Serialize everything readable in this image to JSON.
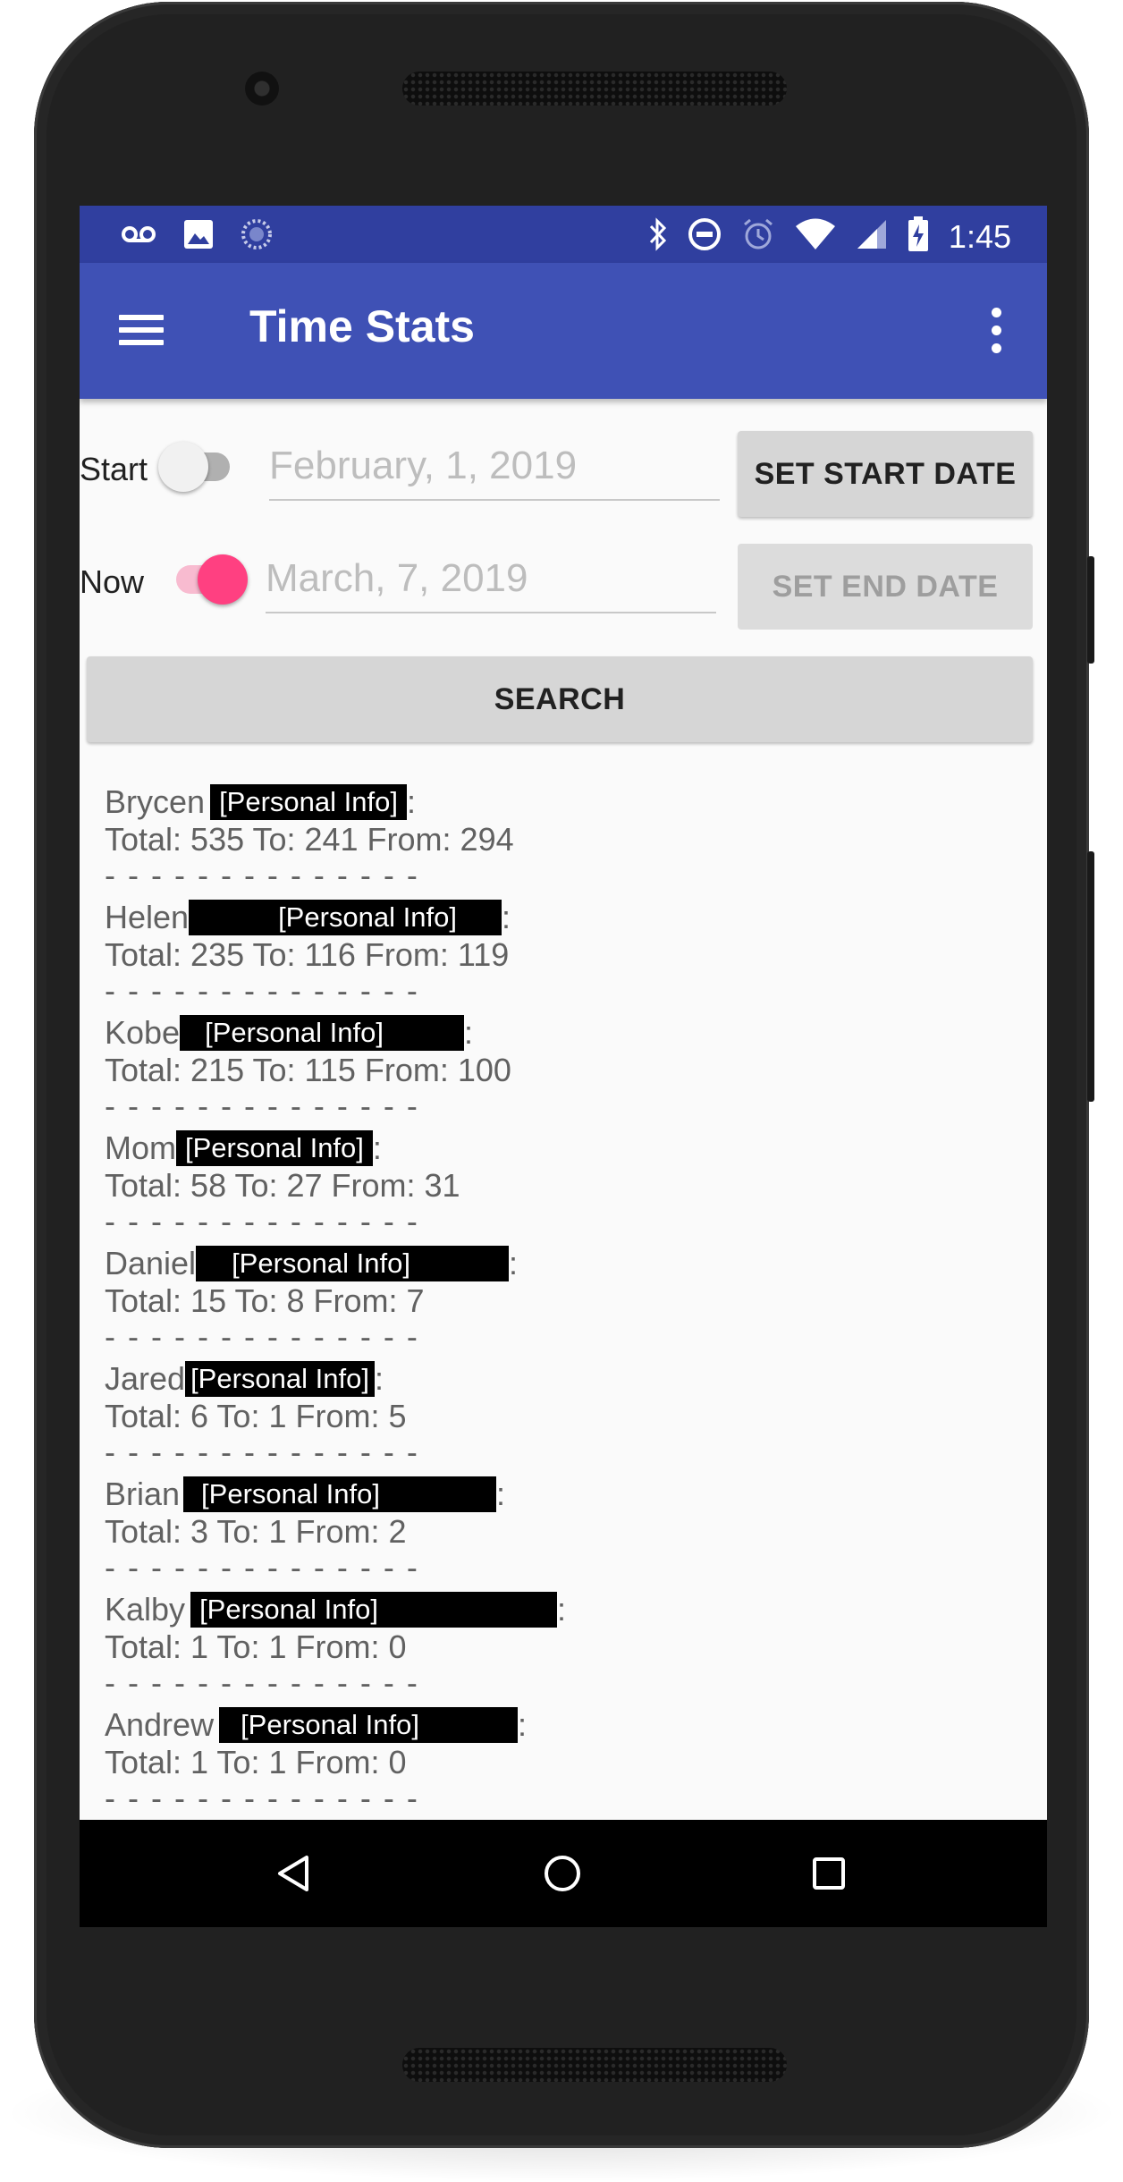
{
  "status_bar": {
    "left_icons": [
      "voicemail-icon",
      "image-icon",
      "sync-icon"
    ],
    "right_icons": [
      "bluetooth-icon",
      "do-not-disturb-icon",
      "alarm-icon",
      "wifi-icon",
      "signal-icon",
      "battery-charging-icon"
    ],
    "time": "1:45"
  },
  "app_bar": {
    "title": "Time Stats"
  },
  "controls": {
    "start_label": "Start",
    "start_switch_on": false,
    "start_date_placeholder": "February, 1, 2019",
    "set_start_label": "SET START DATE",
    "now_label": "Now",
    "now_switch_on": true,
    "end_date_placeholder": "March, 7, 2019",
    "set_end_label": "SET END DATE",
    "search_label": "SEARCH"
  },
  "results": [
    {
      "name": "Brycen",
      "redacted": "[Personal Info]",
      "stats": "Total: 535 To: 241 From: 294",
      "sep": "- - - - - - - - - - - - - -"
    },
    {
      "name": "Helen",
      "redacted": "[Personal Info]",
      "stats": "Total: 235 To: 116 From: 119",
      "sep": "- - - - - - - - - - - - - -"
    },
    {
      "name": "Kobe",
      "redacted": "[Personal Info]",
      "stats": "Total: 215 To: 115 From: 100",
      "sep": "- - - - - - - - - - - - - -"
    },
    {
      "name": "Mom",
      "redacted": "[Personal Info]",
      "stats": "Total: 58 To: 27 From: 31",
      "sep": "- - - - - - - - - - - - - -"
    },
    {
      "name": "Daniel",
      "redacted": "[Personal Info]",
      "stats": "Total: 15 To: 8 From: 7",
      "sep": "- - - - - - - - - - - - - -"
    },
    {
      "name": "Jared",
      "redacted": "[Personal Info]",
      "stats": "Total: 6 To: 1 From: 5",
      "sep": "- - - - - - - - - - - - - -"
    },
    {
      "name": "Brian",
      "redacted": "[Personal Info]",
      "stats": "Total: 3 To: 1 From: 2",
      "sep": "- - - - - - - - - - - - - -"
    },
    {
      "name": "Kalby",
      "redacted": "[Personal Info]",
      "stats": "Total: 1 To: 1 From: 0",
      "sep": "- - - - - - - - - - - - - -"
    },
    {
      "name": "Andrew",
      "redacted": "[Personal Info]",
      "stats": "Total: 1 To: 1 From: 0",
      "sep": "- - - - - - - - - - - - - -"
    }
  ],
  "colon": ":",
  "nav_bar": {
    "buttons": [
      "back-icon",
      "home-icon",
      "recents-icon"
    ]
  },
  "colors": {
    "status_bar": "#303f9f",
    "app_bar": "#3f51b5",
    "accent": "#ff4081",
    "accent_track": "#f8bbd0"
  }
}
